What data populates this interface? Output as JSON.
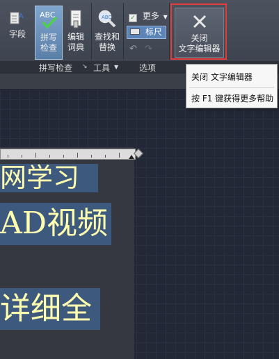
{
  "ribbon": {
    "buttons": {
      "field": "字段",
      "spell_top": "拼写",
      "spell_bottom": "检查",
      "edit_top": "编辑",
      "edit_bottom": "词典",
      "find_top": "查找和",
      "find_bottom": "替换",
      "more": "更多",
      "ruler": "标尺",
      "close_top": "关闭",
      "close_bottom": "文字编辑器"
    },
    "groups": {
      "spell": "拼写检查",
      "tools": "工具",
      "options": "选项"
    }
  },
  "tooltip": {
    "title": "关闭 文字编辑器",
    "help": "按 F1 键获得更多帮助"
  },
  "editor": {
    "lines": [
      "网学习",
      "AD视频",
      "详细全"
    ]
  },
  "colors": {
    "selection": "#3d5a7e",
    "text": "#ffffb0",
    "highlight_border": "#e23b3b"
  }
}
